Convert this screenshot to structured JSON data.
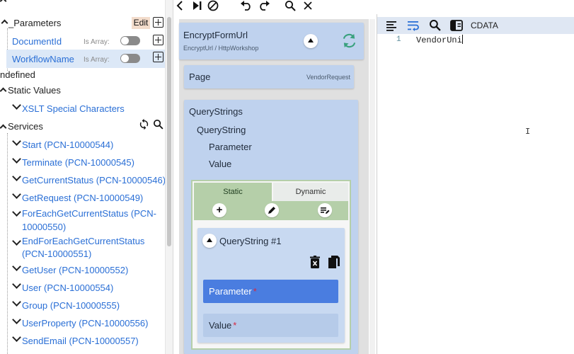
{
  "tree": {
    "parameters": {
      "label": "_Parameters",
      "edit_label": "Edit",
      "items": [
        {
          "label": "DocumentId",
          "is_array_label": "Is Array:"
        },
        {
          "label": "WorkflowName",
          "is_array_label": "Is Array:"
        }
      ]
    },
    "undefined_label": "ndefined",
    "static_values": {
      "label": "Static Values",
      "children": [
        "XSLT Special Characters"
      ]
    },
    "services": {
      "label": "Services",
      "items": [
        {
          "lines": [
            "Start (PCN-10000544)"
          ]
        },
        {
          "lines": [
            "Terminate (PCN-10000545)"
          ]
        },
        {
          "lines": [
            "GetCurrentStatus (PCN-10000546)"
          ]
        },
        {
          "lines": [
            "GetRequest (PCN-10000549)"
          ]
        },
        {
          "lines": [
            "ForEachGetCurrentStatus (PCN-",
            "10000550)"
          ]
        },
        {
          "lines": [
            "EndForEachGetCurrentStatus",
            "(PCN-10000551)"
          ]
        },
        {
          "lines": [
            "GetUser (PCN-10000552)"
          ]
        },
        {
          "lines": [
            "User (PCN-10000554)"
          ]
        },
        {
          "lines": [
            "Group (PCN-10000555)"
          ]
        },
        {
          "lines": [
            "UserProperty (PCN-10000556)"
          ]
        },
        {
          "lines": [
            "SendEmail (PCN-10000557)"
          ]
        }
      ]
    }
  },
  "middle": {
    "header": {
      "title": "EncryptFormUrl",
      "subtitle": "EncryptUrl / HttpWorkshop"
    },
    "page": {
      "label": "Page",
      "value": "VendorRequest"
    },
    "querystrings": {
      "label": "QueryStrings",
      "child": "QueryString",
      "fields": [
        "Parameter",
        "Value"
      ]
    },
    "tabs": {
      "static": "Static",
      "dynamic": "Dynamic"
    },
    "item": {
      "title": "QueryString #1",
      "parameter_label": "Parameter",
      "value_label": "Value",
      "required_mark": "*"
    }
  },
  "editor": {
    "cdata_label": "CDATA",
    "line_number": "1",
    "code_text": "VendorUni"
  },
  "colors": {
    "link": "#2a6fd6",
    "card_bg": "#bfd2ee",
    "selected_field": "#4a7de0",
    "tab_green": "#b5cfa9",
    "required": "#d7263d"
  }
}
